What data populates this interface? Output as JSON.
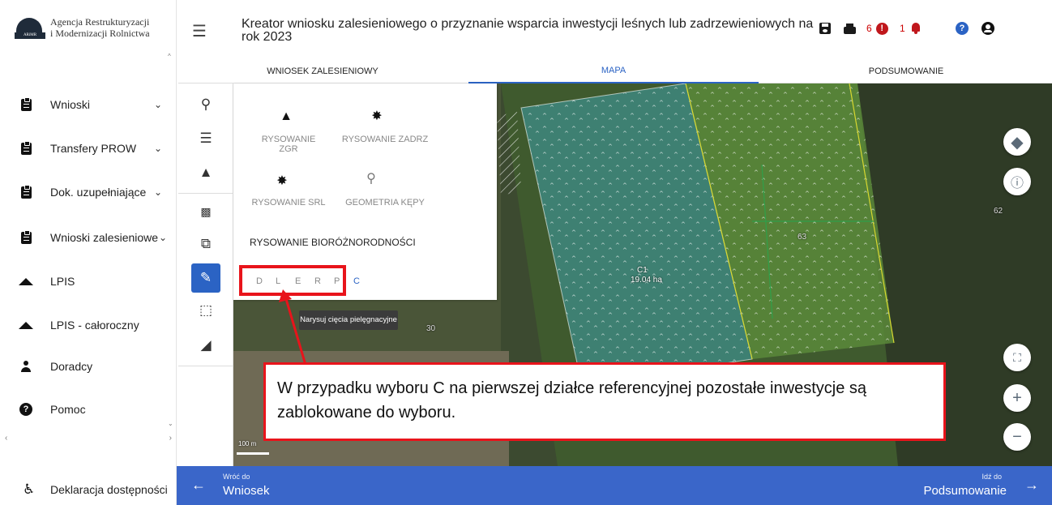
{
  "brand": {
    "line1": "Agencja Restrukturyzacji",
    "line2": "i Modernizacji Rolnictwa",
    "logo_text": "ARiMR"
  },
  "sidebar": {
    "items": [
      {
        "label": "Wnioski",
        "icon": "clipboard-icon",
        "expandable": true
      },
      {
        "label": "Transfery PROW",
        "icon": "clipboard-icon",
        "expandable": true
      },
      {
        "label": "Dok. uzupełniające",
        "icon": "clipboard-icon",
        "expandable": true
      },
      {
        "label": "Wnioski zalesieniowe",
        "icon": "clipboard-icon",
        "expandable": true
      },
      {
        "label": "LPIS",
        "icon": "mountain-icon",
        "expandable": false
      },
      {
        "label": "LPIS - całoroczny",
        "icon": "mountain-icon",
        "expandable": false
      },
      {
        "label": "Doradcy",
        "icon": "person-icon",
        "expandable": false
      },
      {
        "label": "Pomoc",
        "icon": "question-icon",
        "expandable": false
      }
    ],
    "accessibility": "Deklaracja dostępności"
  },
  "header": {
    "title": "Kreator wniosku zalesieniowego o przyznanie wsparcia inwestycji leśnych lub zadrzewieniowych na rok 2023",
    "error_count": "6",
    "notification_count": "1"
  },
  "tabs": [
    {
      "label": "WNIOSEK ZALESIENIOWY",
      "active": false
    },
    {
      "label": "MAPA",
      "active": true
    },
    {
      "label": "PODSUMOWANIE",
      "active": false
    }
  ],
  "draw_panel": {
    "options": [
      {
        "label": "RYSOWANIE ZGR",
        "icon": "tree-icon"
      },
      {
        "label": "RYSOWANIE ZADRZ",
        "icon": "sprout-icon"
      },
      {
        "label": "RYSOWANIE SRL",
        "icon": "seedling-icon"
      },
      {
        "label": "GEOMETRIA KĘPY",
        "icon": "pin-icon"
      }
    ],
    "biodiversity_title": "RYSOWANIE BIORÓŻNORODNOŚCI",
    "letters": [
      "D",
      "L",
      "E",
      "R",
      "P",
      "C"
    ]
  },
  "tooltip": "Narysuj cięcia pielęgnacyjne",
  "callout": "W przypadku wyboru C na pierwszej działce referencyjnej pozostałe inwestycje są zablokowane do wyboru.",
  "map": {
    "plot_label": "C1",
    "plot_area": "19.04 ha",
    "parcel_62": "62",
    "parcel_63": "63",
    "parcel_30": "30",
    "scale_label": "100 m"
  },
  "bottom": {
    "back_small": "Wróć do",
    "back_main": "Wniosek",
    "next_small": "Idź do",
    "next_main": "Podsumowanie"
  }
}
